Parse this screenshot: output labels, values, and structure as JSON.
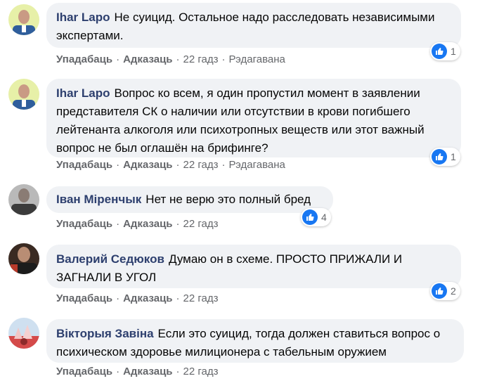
{
  "labels": {
    "like": "Упадабаць",
    "reply": "Адказаць",
    "edited": "Рэдагавана",
    "dot": "·"
  },
  "comments": [
    {
      "author": "Ihar Lapo",
      "text": "Не суицид. Остальное надо расследовать независимыми экспертами.",
      "time": "22 гадз",
      "reactions": "1",
      "edited": true
    },
    {
      "author": "Ihar Lapo",
      "text": "Вопрос ко всем, я один пропустил момент в заявлении представителя СК о наличии или отсутствии в крови погибшего лейтенанта алкоголя или психотропных веществ или этот важный вопрос не был оглашён на брифинге?",
      "time": "22 гадз",
      "reactions": "1",
      "edited": true
    },
    {
      "author": "Іван Міренчык",
      "text": "Нет не верю это полный бред",
      "time": "22 гадз",
      "reactions": "4",
      "edited": false
    },
    {
      "author": "Валерий Седюков",
      "text": "Думаю он в схеме. ПРОСТО ПРИЖАЛИ И ЗАГНАЛИ В УГОЛ",
      "time": "22 гадз",
      "reactions": "2",
      "edited": false
    },
    {
      "author": "Вікторыя Завіна",
      "text": "Если это суицид, тогда должен ставиться вопрос о психическом здоровье милиционера с табельным оружием",
      "time": "22 гадз",
      "reactions": "",
      "edited": false
    }
  ],
  "colors": {
    "link": "#2d3f6e",
    "bubble": "#f0f2f5",
    "meta": "#65676b",
    "like": "#1877f2"
  }
}
